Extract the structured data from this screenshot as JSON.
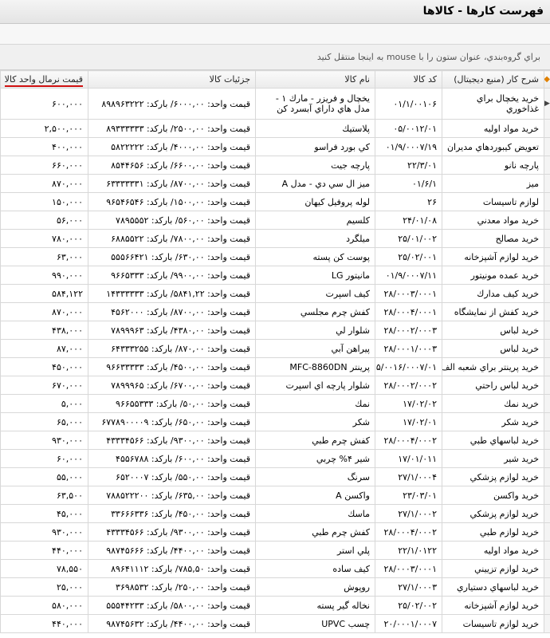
{
  "window": {
    "title": "فهرست كارها - كالاها",
    "group_hint": "براي گروه‌بندي، عنوان ستون را با mouse به اينجا منتقل كنيد"
  },
  "grid": {
    "header_marker": "◆",
    "row_marker": "▶",
    "columns": {
      "normal_price": "قيمت نرمال واحد كالا",
      "details": "جزئيات كالا",
      "name": "نام كالا",
      "code": "كد كالا",
      "desc": "شرح كار (منبع ديجيتال)"
    },
    "rows": [
      {
        "desc": "خريد يخچال براي غذاخوري",
        "code": "۰۱/۱/۰۰۱۰۶",
        "name": "يخچال و فريزر - مارك ۱ - مدل هاي داراي آبسرد كن",
        "details": "قيمت واحد: ۶۰۰۰,۰۰/ باركد: ۸۹۸۹۶۳۲۲۲",
        "price": "۶۰۰,۰۰۰"
      },
      {
        "desc": "خريد مواد اوليه",
        "code": "۰۵/۰۰۱۲/۰۱",
        "name": "پلاستيك",
        "details": "قيمت واحد: ۲۵۰۰,۰۰/ باركد: ۸۹۳۳۳۳۳۳",
        "price": "۲,۵۰۰,۰۰۰"
      },
      {
        "desc": "تعويض كيبوردهاي مديران",
        "code": "۰۱/۹/۰۰۰۷/۱۹",
        "name": "كي بورد فراسو",
        "details": "قيمت واحد: ۴۰۰۰,۰۰/ باركد: ۵۸۲۲۲۲۲",
        "price": "۴۰۰,۰۰۰"
      },
      {
        "desc": "پارچه نانو",
        "code": "۲۲/۳/۰۱",
        "name": "پارچه جيت",
        "details": "قيمت واحد: ۶۶۰۰,۰۰/ باركد: ۸۵۴۴۶۵۶",
        "price": "۶۶۰,۰۰۰"
      },
      {
        "desc": "ميز",
        "code": "۰۱/۶/۱",
        "name": "ميز ال سي دي - مدل A",
        "details": "قيمت واحد: ۸۷۰۰,۰۰/ باركد: ۶۳۳۳۳۳۳۱",
        "price": "۸۷۰,۰۰۰"
      },
      {
        "desc": "لوازم تاسيسات",
        "code": "۲۶",
        "name": "لوله پروفيل كيهان",
        "details": "قيمت واحد: ۱۵۰۰,۰۰/ باركد: ۹۶۵۴۶۵۴۶",
        "price": "۱۵۰,۰۰۰"
      },
      {
        "desc": "خريد مواد معدني",
        "code": "۲۴/۰۱/۰۸",
        "name": "كلسيم",
        "details": "قيمت واحد: ۵۶۰,۰۰/ باركد: ۷۸۹۵۵۵۲",
        "price": "۵۶,۰۰۰"
      },
      {
        "desc": "خريد مصالح",
        "code": "۲۵/۰۱/۰۰۲",
        "name": "ميلگرد",
        "details": "قيمت واحد: ۷۸۰۰,۰۰/ باركد: ۶۸۸۵۵۲۲",
        "price": "۷۸۰,۰۰۰"
      },
      {
        "desc": "خريد لوازم آشپزخانه",
        "code": "۲۵/۰۲/۰۰۱",
        "name": "پوست كن پسته",
        "details": "قيمت واحد: ۶۳۰,۰۰/ باركد: ۵۵۵۶۶۴۲۱",
        "price": "۶۳,۰۰۰"
      },
      {
        "desc": "خريد عمده مونيتور",
        "code": "۰۱/۹/۰۰۰۷/۱۱",
        "name": "مانيتور LG",
        "details": "قيمت واحد: ۹۹۰۰,۰۰/ باركد: ۹۶۶۵۳۳۳",
        "price": "۹۹۰,۰۰۰"
      },
      {
        "desc": "خريد كيف مدارك",
        "code": "۲۸/۰۰۰۳/۰۰۰۱",
        "name": "كيف اسپرت",
        "details": "قيمت واحد: ۵۸۴۱,۲۲/ باركد: ۱۴۳۳۳۳۳۳",
        "price": "۵۸۴,۱۲۲"
      },
      {
        "desc": "خريد كفش از نمايشگاه",
        "code": "۲۸/۰۰۰۴/۰۰۰۱",
        "name": "كفش چرم مجلسي",
        "details": "قيمت واحد: ۸۷۰۰,۰۰/ باركد: ۴۵۶۲۰۰۰",
        "price": "۸۷۰,۰۰۰"
      },
      {
        "desc": "خريد لباس",
        "code": "۲۸/۰۰۰۲/۰۰۰۳",
        "name": "شلوار لي",
        "details": "قيمت واحد: ۴۳۸۰,۰۰/ باركد: ۷۸۹۹۹۶۳",
        "price": "۴۳۸,۰۰۰"
      },
      {
        "desc": "خريد لباس",
        "code": "۲۸/۰۰۰۱/۰۰۰۳",
        "name": "پيراهن آبي",
        "details": "قيمت واحد: ۸۷۰,۰۰/ باركد: ۶۴۳۳۳۲۵۵",
        "price": "۸۷,۰۰۰"
      },
      {
        "desc": "خريد پرينتر براي شعبه الف",
        "code": "۰۵/۰۰۱۶/۰۰۰۷/۰۱",
        "name": "پرينتر MFC-8860DN",
        "details": "قيمت واحد: ۴۵۰۰,۰۰/ باركد: ۹۶۶۳۳۳۳۳",
        "price": "۴۵۰,۰۰۰"
      },
      {
        "desc": "خريد لباس راحتي",
        "code": "۲۸/۰۰۰۲/۰۰۰۲",
        "name": "شلوار پارچه اي اسپرت",
        "details": "قيمت واحد: ۶۷۰۰,۰۰/ باركد: ۷۸۹۹۹۶۵",
        "price": "۶۷۰,۰۰۰"
      },
      {
        "desc": "خريد نمك",
        "code": "۱۷/۰۲/۰۲",
        "name": "نمك",
        "details": "قيمت واحد: ۵۰,۰۰/ باركد: ۹۶۶۵۵۳۳۳",
        "price": "۵,۰۰۰"
      },
      {
        "desc": "خريد شكر",
        "code": "۱۷/۰۲/۰۱",
        "name": "شكر",
        "details": "قيمت واحد: ۶۵۰,۰۰/ باركد: ۶۷۷۸۹۰۰۰۰۹",
        "price": "۶۵,۰۰۰"
      },
      {
        "desc": "خريد لباسهاي طبي",
        "code": "۲۸/۰۰۰۴/۰۰۰۲",
        "name": "كفش چرم طبي",
        "details": "قيمت واحد: ۹۳۰۰,۰۰/ باركد: ۴۳۳۳۴۵۶۶",
        "price": "۹۳۰,۰۰۰"
      },
      {
        "desc": "خريد شير",
        "code": "۱۷/۰۱/۰۱۱",
        "name": "شير ۴% چربي",
        "details": "قيمت واحد: ۶۰۰,۰۰/ باركد: ۴۵۵۶۷۸۸",
        "price": "۶۰,۰۰۰"
      },
      {
        "desc": "خريد لوازم پزشكي",
        "code": "۲۷/۱/۰۰۰۴",
        "name": "سرنگ",
        "details": "قيمت واحد: ۵۵۰,۰۰/ باركد: ۶۵۲۰۰۰۷",
        "price": "۵۵,۰۰۰"
      },
      {
        "desc": "خريد واكسن",
        "code": "۲۳/۰۳/۰۱",
        "name": "واكسن A",
        "details": "قيمت واحد: ۶۳۵,۰۰/ باركد: ۷۸۸۵۲۲۲۰۰",
        "price": "۶۳,۵۰۰"
      },
      {
        "desc": "خريد لوازم پزشكي",
        "code": "۲۷/۱/۰۰۰۲",
        "name": "ماسك",
        "details": "قيمت واحد: ۴۵۰,۰۰/ باركد: ۳۳۶۶۶۳۳۶",
        "price": "۴۵,۰۰۰"
      },
      {
        "desc": "خريد لوازم طبي",
        "code": "۲۸/۰۰۰۴/۰۰۰۲",
        "name": "كفش چرم طبي",
        "details": "قيمت واحد: ۹۳۰۰,۰۰/ باركد: ۴۳۳۳۴۵۶۶",
        "price": "۹۳۰,۰۰۰"
      },
      {
        "desc": "خريد مواد اوليه",
        "code": "۲۲/۱/۰۱۲۲",
        "name": "پلي استر",
        "details": "قيمت واحد: ۴۴۰۰,۰۰/ باركد: ۹۸۷۴۵۶۶۶",
        "price": "۴۴۰,۰۰۰"
      },
      {
        "desc": "خريد لوازم تزييني",
        "code": "۲۸/۰۰۰۳/۰۰۰۱",
        "name": "كيف ساده",
        "details": "قيمت واحد: ۷۸۵,۵۰/ باركد: ۸۹۶۴۱۱۱۲",
        "price": "۷۸,۵۵۰"
      },
      {
        "desc": "خريد لباسهاي دستياري",
        "code": "۲۷/۱/۰۰۰۳",
        "name": "روپوش",
        "details": "قيمت واحد: ۲۵۰,۰۰/ باركد: ۳۶۹۸۵۳۲",
        "price": "۲۵,۰۰۰"
      },
      {
        "desc": "خريد لوازم آشپزخانه",
        "code": "۲۵/۰۲/۰۰۲",
        "name": "نخاله گير پسته",
        "details": "قيمت واحد: ۵۸۰۰,۰۰/ باركد: ۵۵۵۴۴۲۳۳",
        "price": "۵۸۰,۰۰۰"
      },
      {
        "desc": "خريد لوازم تاسيسات",
        "code": "۲۰/۰۰۰۱/۰۰۰۷",
        "name": "چسب UPVC",
        "details": "قيمت واحد: ۴۴۰۰,۰۰/ باركد: ۹۸۷۴۵۶۳۲",
        "price": "۴۴۰,۰۰۰"
      }
    ]
  }
}
